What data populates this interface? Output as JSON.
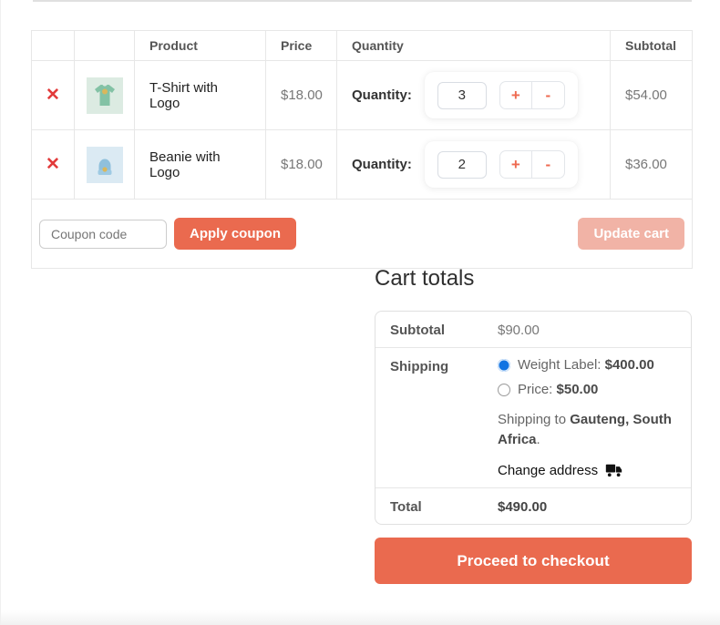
{
  "cart_table": {
    "headers": {
      "product": "Product",
      "price": "Price",
      "quantity": "Quantity",
      "subtotal": "Subtotal"
    },
    "remove_icon": "✕",
    "quantity_label": "Quantity:",
    "plus_label": "+",
    "minus_label": "-",
    "rows": [
      {
        "name": "T-Shirt with Logo",
        "price": "$18.00",
        "quantity": "3",
        "subtotal": "$54.00",
        "thumb": "tshirt-thumbnail"
      },
      {
        "name": "Beanie with Logo",
        "price": "$18.00",
        "quantity": "2",
        "subtotal": "$36.00",
        "thumb": "beanie-thumbnail"
      }
    ],
    "coupon": {
      "placeholder": "Coupon code",
      "apply_label": "Apply coupon",
      "update_label": "Update cart",
      "update_disabled": true
    }
  },
  "cart_totals": {
    "title": "Cart totals",
    "subtotal_label": "Subtotal",
    "subtotal_value": "$90.00",
    "shipping_label": "Shipping",
    "shipping_options": [
      {
        "prefix": "Weight Label:",
        "amount": "$400.00",
        "selected": true
      },
      {
        "prefix": "Price:",
        "amount": "$50.00",
        "selected": false
      }
    ],
    "destination_prefix": "Shipping to",
    "destination": "Gauteng, South Africa",
    "destination_suffix": ".",
    "change_address_label": "Change address",
    "total_label": "Total",
    "total_value": "$490.00"
  },
  "checkout": {
    "label": "Proceed to checkout"
  },
  "colors": {
    "accent": "#ea6a4f",
    "accent_disabled": "#f1b3a6",
    "remove_red": "#e23b3b",
    "radio_selected_blue": "#1173e2"
  }
}
